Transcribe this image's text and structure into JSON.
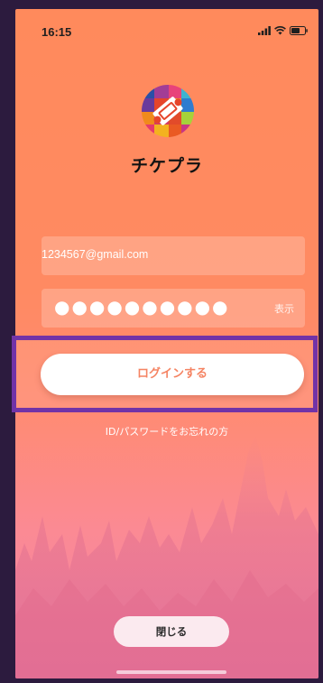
{
  "status_bar": {
    "time": "16:15"
  },
  "app": {
    "name": "チケプラ"
  },
  "login_form": {
    "email_value": "1234567@gmail.com",
    "password_masked": "●●●●●●●●●●",
    "show_password_label": "表示",
    "login_button_label": "ログインする",
    "forgot_link_label": "ID/パスワードをお忘れの方"
  },
  "footer": {
    "close_button_label": "閉じる"
  },
  "colors": {
    "background": "#ff8a5c",
    "accent": "#f57a56",
    "highlight_border": "#7133a7"
  },
  "icons": {
    "logo": "ticket-logo-icon",
    "signal": "cellular-signal-icon",
    "wifi": "wifi-icon",
    "battery": "battery-icon"
  }
}
